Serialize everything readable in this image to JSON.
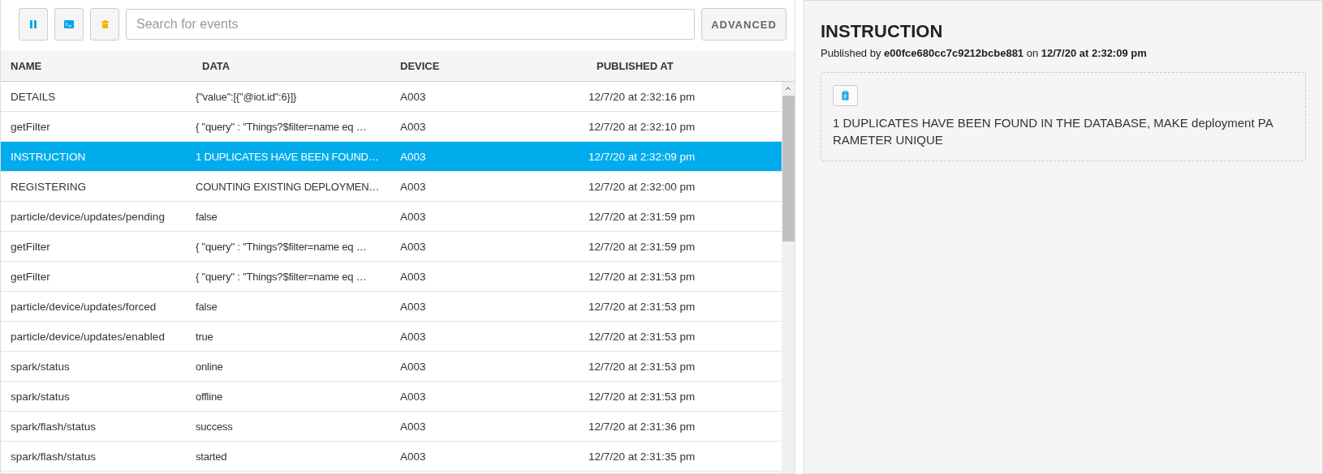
{
  "toolbar": {
    "search": {
      "placeholder": "Search for events"
    },
    "advanced_button": "ADVANCED"
  },
  "table": {
    "columns": [
      "NAME",
      "DATA",
      "DEVICE",
      "PUBLISHED AT"
    ],
    "rows": [
      {
        "name": "DETAILS",
        "data": "{\"value\":[{\"@iot.id\":6}]}",
        "device": "A003",
        "published_at": "12/7/20 at 2:32:16 pm",
        "selected": false
      },
      {
        "name": "getFilter",
        "data": "{ \"query\" : \"Things?$filter=name eq …",
        "device": "A003",
        "published_at": "12/7/20 at 2:32:10 pm",
        "selected": false
      },
      {
        "name": "INSTRUCTION",
        "data": "1 DUPLICATES HAVE BEEN FOUND…",
        "device": "A003",
        "published_at": "12/7/20 at 2:32:09 pm",
        "selected": true
      },
      {
        "name": "REGISTERING",
        "data": "COUNTING EXISTING DEPLOYMEN…",
        "device": "A003",
        "published_at": "12/7/20 at 2:32:00 pm",
        "selected": false
      },
      {
        "name": "particle/device/updates/pending",
        "data": "false",
        "device": "A003",
        "published_at": "12/7/20 at 2:31:59 pm",
        "selected": false
      },
      {
        "name": "getFilter",
        "data": "{ \"query\" : \"Things?$filter=name eq …",
        "device": "A003",
        "published_at": "12/7/20 at 2:31:59 pm",
        "selected": false
      },
      {
        "name": "getFilter",
        "data": "{ \"query\" : \"Things?$filter=name eq …",
        "device": "A003",
        "published_at": "12/7/20 at 2:31:53 pm",
        "selected": false
      },
      {
        "name": "particle/device/updates/forced",
        "data": "false",
        "device": "A003",
        "published_at": "12/7/20 at 2:31:53 pm",
        "selected": false
      },
      {
        "name": "particle/device/updates/enabled",
        "data": "true",
        "device": "A003",
        "published_at": "12/7/20 at 2:31:53 pm",
        "selected": false
      },
      {
        "name": "spark/status",
        "data": "online",
        "device": "A003",
        "published_at": "12/7/20 at 2:31:53 pm",
        "selected": false
      },
      {
        "name": "spark/status",
        "data": "offline",
        "device": "A003",
        "published_at": "12/7/20 at 2:31:53 pm",
        "selected": false
      },
      {
        "name": "spark/flash/status",
        "data": "success",
        "device": "A003",
        "published_at": "12/7/20 at 2:31:36 pm",
        "selected": false
      },
      {
        "name": "spark/flash/status",
        "data": "started",
        "device": "A003",
        "published_at": "12/7/20 at 2:31:35 pm",
        "selected": false
      }
    ]
  },
  "detail": {
    "title": "INSTRUCTION",
    "published_text": "Published by **e00fce680cc7c9212bcbe881** on **12/7/20 at 2:32:09 pm**",
    "body": "1 DUPLICATES HAVE BEEN FOUND IN THE DATABASE, MAKE deployment PA RAMETER UNIQUE"
  }
}
